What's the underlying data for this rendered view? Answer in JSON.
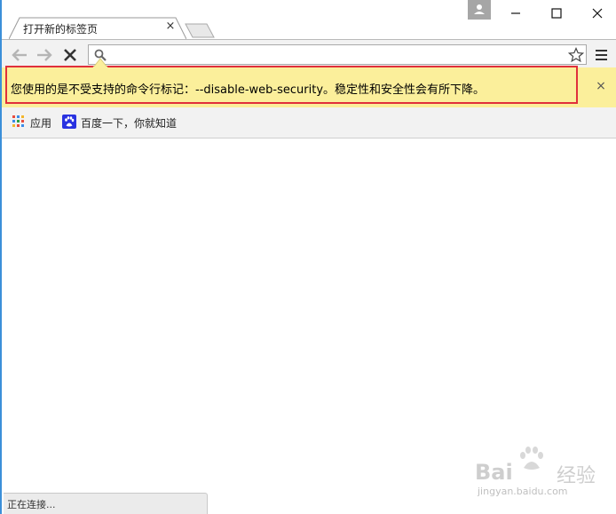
{
  "tab": {
    "title": "打开新的标签页",
    "close_label": "×"
  },
  "window_controls": {
    "minimize": "minimize",
    "maximize": "maximize",
    "close": "close"
  },
  "toolbar": {
    "omnibox_value": ""
  },
  "infobar": {
    "message": "您使用的是不受支持的命令行标记：--disable-web-security。稳定性和安全性会有所下降。",
    "close_label": "×",
    "background_color": "#fbef9b",
    "highlight_color": "#e0303b"
  },
  "bookmarks": [
    {
      "label": "应用",
      "icon": "apps-grid-icon"
    },
    {
      "label": "百度一下，你就知道",
      "icon": "baidu-paw-icon"
    }
  ],
  "status": {
    "text": "正在连接..."
  },
  "watermark": {
    "logo": "Bai",
    "logo_suffix": "经验",
    "url": "jingyan.baidu.com"
  }
}
